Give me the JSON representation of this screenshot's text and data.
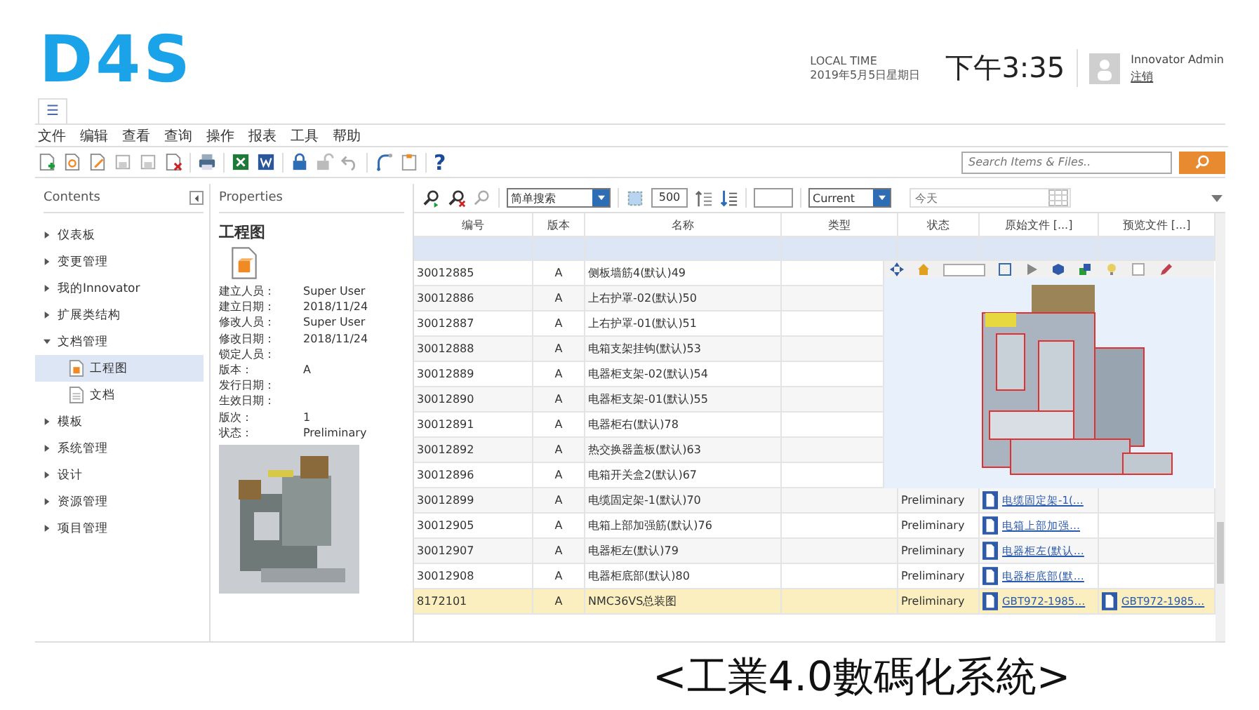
{
  "logo": "D4S",
  "header": {
    "time_label": "LOCAL TIME",
    "date": "2019年5月5日星期日",
    "clock": "下午3:35",
    "user_name": "Innovator Admin",
    "logout": "注销"
  },
  "tab_icon": "☰",
  "menu": [
    "文件",
    "编辑",
    "查看",
    "查询",
    "操作",
    "报表",
    "工具",
    "帮助"
  ],
  "toolbar": {
    "help": "?",
    "search": {
      "placeholder": "Search Items & Files.."
    }
  },
  "contents": {
    "title": "Contents",
    "items": [
      {
        "label": "仪表板",
        "expanded": false
      },
      {
        "label": "变更管理",
        "expanded": false
      },
      {
        "label": "我的Innovator",
        "expanded": false
      },
      {
        "label": "扩展类结构",
        "expanded": false
      },
      {
        "label": "文档管理",
        "expanded": true,
        "children": [
          {
            "label": "工程图",
            "kind": "cad",
            "selected": true
          },
          {
            "label": "文档",
            "kind": "doc",
            "selected": false
          }
        ]
      },
      {
        "label": "模板",
        "expanded": false
      },
      {
        "label": "系统管理",
        "expanded": false
      },
      {
        "label": "设计",
        "expanded": false
      },
      {
        "label": "资源管理",
        "expanded": false
      },
      {
        "label": "项目管理",
        "expanded": false
      }
    ]
  },
  "properties": {
    "title": "Properties",
    "item_title": "工程图",
    "fields": [
      {
        "label": "建立人员：",
        "value": "Super User"
      },
      {
        "label": "建立日期：",
        "value": "2018/11/24"
      },
      {
        "label": "修改人员：",
        "value": "Super User"
      },
      {
        "label": "修改日期：",
        "value": "2018/11/24"
      },
      {
        "label": "锁定人员："
      },
      {
        "label": "版本：",
        "value": "A"
      },
      {
        "label": "发行日期："
      },
      {
        "label": "生效日期："
      },
      {
        "label": "版次：",
        "value": "1"
      },
      {
        "label": "状态：",
        "value": "Preliminary"
      }
    ]
  },
  "grid": {
    "search_mode": "简单搜索",
    "page_size": "500",
    "version": "Current",
    "date_placeholder": "今天",
    "columns": [
      "编号",
      "版本",
      "名称",
      "类型",
      "状态",
      "原始文件 [...]",
      "预览文件 [...]"
    ],
    "rows": [
      {
        "number": "30012885",
        "rev": "A",
        "name": "侧板墙筋4(默认)49",
        "selected": false
      },
      {
        "number": "30012886",
        "rev": "A",
        "name": "上右护罩-02(默认)50",
        "selected": false
      },
      {
        "number": "30012887",
        "rev": "A",
        "name": "上右护罩-01(默认)51",
        "selected": false
      },
      {
        "number": "30012888",
        "rev": "A",
        "name": "电箱支架挂钩(默认)53",
        "selected": false
      },
      {
        "number": "30012889",
        "rev": "A",
        "name": "电器柜支架-02(默认)54",
        "selected": false
      },
      {
        "number": "30012890",
        "rev": "A",
        "name": "电器柜支架-01(默认)55",
        "selected": false
      },
      {
        "number": "30012891",
        "rev": "A",
        "name": "电器柜右(默认)78",
        "selected": false
      },
      {
        "number": "30012892",
        "rev": "A",
        "name": "热交换器盖板(默认)63",
        "selected": false
      },
      {
        "number": "30012896",
        "rev": "A",
        "name": "电箱开关盒2(默认)67",
        "selected": false
      },
      {
        "number": "30012899",
        "rev": "A",
        "name": "电缆固定架-1(默认)70",
        "status": "Preliminary",
        "original": "电缆固定架-1(…",
        "selected": false
      },
      {
        "number": "30012905",
        "rev": "A",
        "name": "电箱上部加强筋(默认)76",
        "status": "Preliminary",
        "original": "电箱上部加强…",
        "selected": false
      },
      {
        "number": "30012907",
        "rev": "A",
        "name": "电器柜左(默认)79",
        "status": "Preliminary",
        "original": "电器柜左(默认…",
        "selected": false
      },
      {
        "number": "30012908",
        "rev": "A",
        "name": "电器柜底部(默认)80",
        "status": "Preliminary",
        "original": "电器柜底部(默…",
        "selected": false
      },
      {
        "number": "8172101",
        "rev": "A",
        "name": "NMC36VS总装图",
        "status": "Preliminary",
        "original": "GBT972-1985…",
        "preview": "GBT972-1985…",
        "selected": true
      }
    ]
  },
  "caption": "<工業4.0數碼化系統>"
}
